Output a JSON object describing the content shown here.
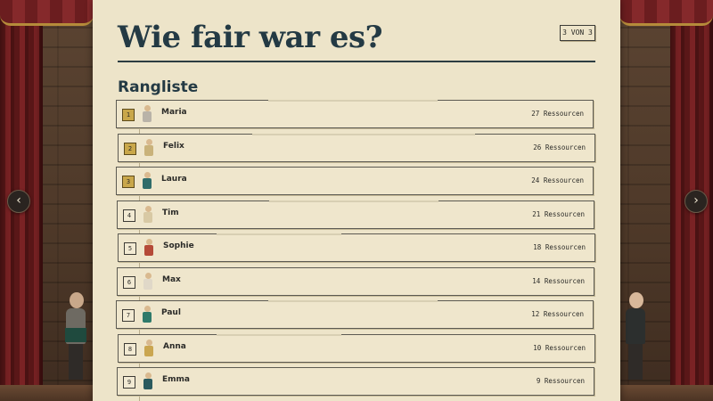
{
  "page": {
    "title": "Wie fair war es?",
    "page_indicator": "3 VON 3",
    "section_title": "Rangliste"
  },
  "navigation": {
    "prev_icon": "chevron-left-icon",
    "next_icon": "chevron-right-icon",
    "prev_glyph": "‹",
    "next_glyph": "›"
  },
  "ranking": [
    {
      "rank": "1",
      "name": "Maria",
      "resources": "27 Ressourcen",
      "highlight": true,
      "avatar_color": "#b9b3a8"
    },
    {
      "rank": "2",
      "name": "Felix",
      "resources": "26 Ressourcen",
      "highlight": true,
      "avatar_color": "#c9b27a"
    },
    {
      "rank": "3",
      "name": "Laura",
      "resources": "24 Ressourcen",
      "highlight": true,
      "avatar_color": "#2f6c6a"
    },
    {
      "rank": "4",
      "name": "Tim",
      "resources": "21 Ressourcen",
      "highlight": false,
      "avatar_color": "#d8c9a4"
    },
    {
      "rank": "5",
      "name": "Sophie",
      "resources": "18 Ressourcen",
      "highlight": false,
      "avatar_color": "#b54a38"
    },
    {
      "rank": "6",
      "name": "Max",
      "resources": "14 Ressourcen",
      "highlight": false,
      "avatar_color": "#e0d8c8"
    },
    {
      "rank": "7",
      "name": "Paul",
      "resources": "12 Ressourcen",
      "highlight": false,
      "avatar_color": "#2f7a6a"
    },
    {
      "rank": "8",
      "name": "Anna",
      "resources": "10 Ressourcen",
      "highlight": false,
      "avatar_color": "#caa650"
    },
    {
      "rank": "9",
      "name": "Emma",
      "resources": "9 Ressourcen",
      "highlight": false,
      "avatar_color": "#2a5a5e"
    }
  ],
  "colors": {
    "panel": "#ede4c9",
    "title": "#243a44",
    "rank_highlight": "#c9a74a"
  }
}
